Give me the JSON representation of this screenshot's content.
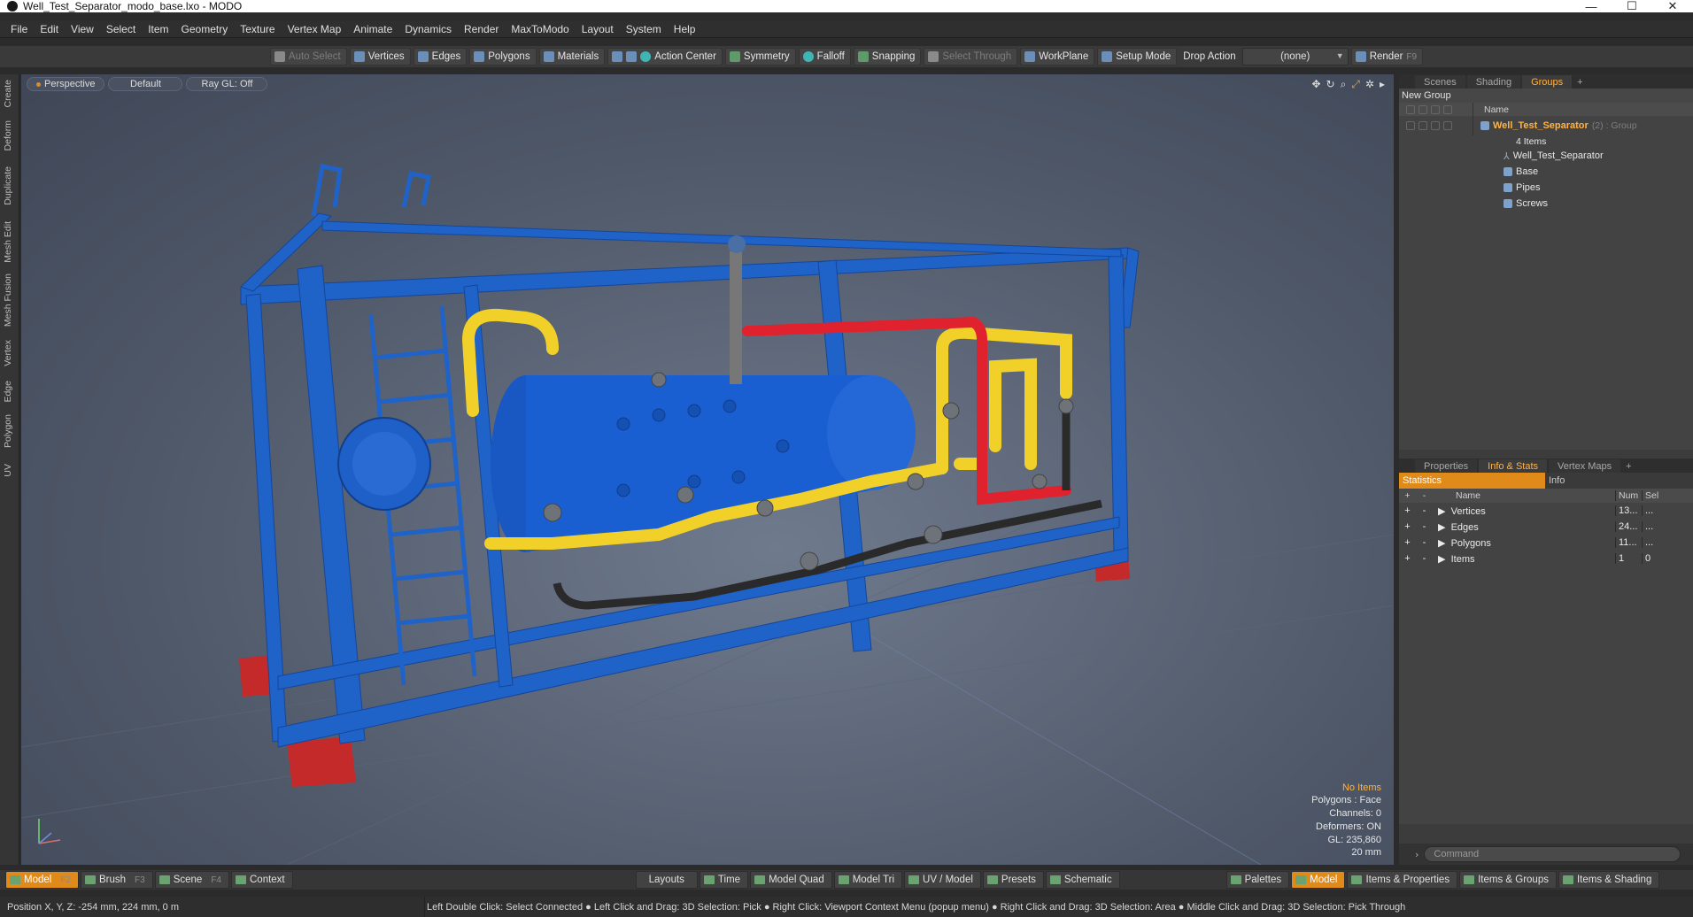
{
  "window": {
    "title": "Well_Test_Separator_modo_base.lxo - MODO",
    "controls": [
      "—",
      "☐",
      "✕"
    ]
  },
  "menu": [
    "File",
    "Edit",
    "View",
    "Select",
    "Item",
    "Geometry",
    "Texture",
    "Vertex Map",
    "Animate",
    "Dynamics",
    "Render",
    "MaxToModo",
    "Layout",
    "System",
    "Help"
  ],
  "toolbar": {
    "auto_select": "Auto Select",
    "vertices": "Vertices",
    "edges": "Edges",
    "polygons": "Polygons",
    "materials": "Materials",
    "action_center": "Action Center",
    "symmetry": "Symmetry",
    "falloff": "Falloff",
    "snapping": "Snapping",
    "select_through": "Select Through",
    "workplane": "WorkPlane",
    "setup_mode": "Setup Mode",
    "drop_action_label": "Drop Action",
    "drop_action_value": "(none)",
    "render": "Render",
    "render_key": "F9"
  },
  "left_tabs": [
    "Create",
    "Deform",
    "Duplicate",
    "Mesh Edit",
    "Mesh Fusion",
    "Vertex",
    "Edge",
    "Polygon",
    "UV"
  ],
  "viewport": {
    "view": "Perspective",
    "shading": "Default",
    "raygl": "Ray GL: Off",
    "info": {
      "selection": "No Items",
      "polygons": "Polygons : Face",
      "channels": "Channels: 0",
      "deformers": "Deformers: ON",
      "gl": "GL: 235,860",
      "grid": "20 mm"
    },
    "colors": {
      "frame": "#1f63c9",
      "vessel": "#1a5fd1",
      "pipe_yellow": "#f2d02a",
      "pipe_red": "#e0222e",
      "pipe_black": "#2a2a2a",
      "feet": "#c42a2a"
    }
  },
  "groups_panel": {
    "tabs": [
      "Scenes",
      "Shading",
      "Groups"
    ],
    "active_tab": "Groups",
    "new_group": "New Group",
    "column_name": "Name",
    "group": {
      "name": "Well_Test_Separator",
      "meta": "(2) : Group",
      "count": "4 Items"
    },
    "children": [
      "Well_Test_Separator",
      "Base",
      "Pipes",
      "Screws"
    ]
  },
  "stats_panel": {
    "tabs": [
      "Properties",
      "Info & Stats",
      "Vertex Maps"
    ],
    "active_tab": "Info & Stats",
    "sub_tabs": [
      "Statistics",
      "Info"
    ],
    "columns": [
      "Name",
      "Num",
      "Sel"
    ],
    "rows": [
      {
        "name": "Vertices",
        "num": "13...",
        "sel": "..."
      },
      {
        "name": "Edges",
        "num": "24...",
        "sel": "..."
      },
      {
        "name": "Polygons",
        "num": "11...",
        "sel": "..."
      },
      {
        "name": "Items",
        "num": "1",
        "sel": "0"
      }
    ]
  },
  "command": {
    "placeholder": "Command"
  },
  "bottom_left": [
    {
      "label": "Model",
      "key": "F2",
      "active": true
    },
    {
      "label": "Brush",
      "key": "F3"
    },
    {
      "label": "Scene",
      "key": "F4"
    },
    {
      "label": "Context",
      "key": ""
    }
  ],
  "bottom_center": [
    "Layouts",
    "Time",
    "Model Quad",
    "Model Tri",
    "UV / Model",
    "Presets",
    "Schematic"
  ],
  "bottom_right": [
    "Palettes",
    "Model",
    "Items & Properties",
    "Items & Groups",
    "Items & Shading"
  ],
  "status": {
    "position": "Position X, Y, Z:   -254 mm, 224 mm, 0 m",
    "hint": "Left Double Click: Select Connected ● Left Click and Drag: 3D Selection: Pick ● Right Click: Viewport Context Menu (popup menu) ● Right Click and Drag: 3D Selection: Area ● Middle Click and Drag: 3D Selection: Pick Through"
  }
}
